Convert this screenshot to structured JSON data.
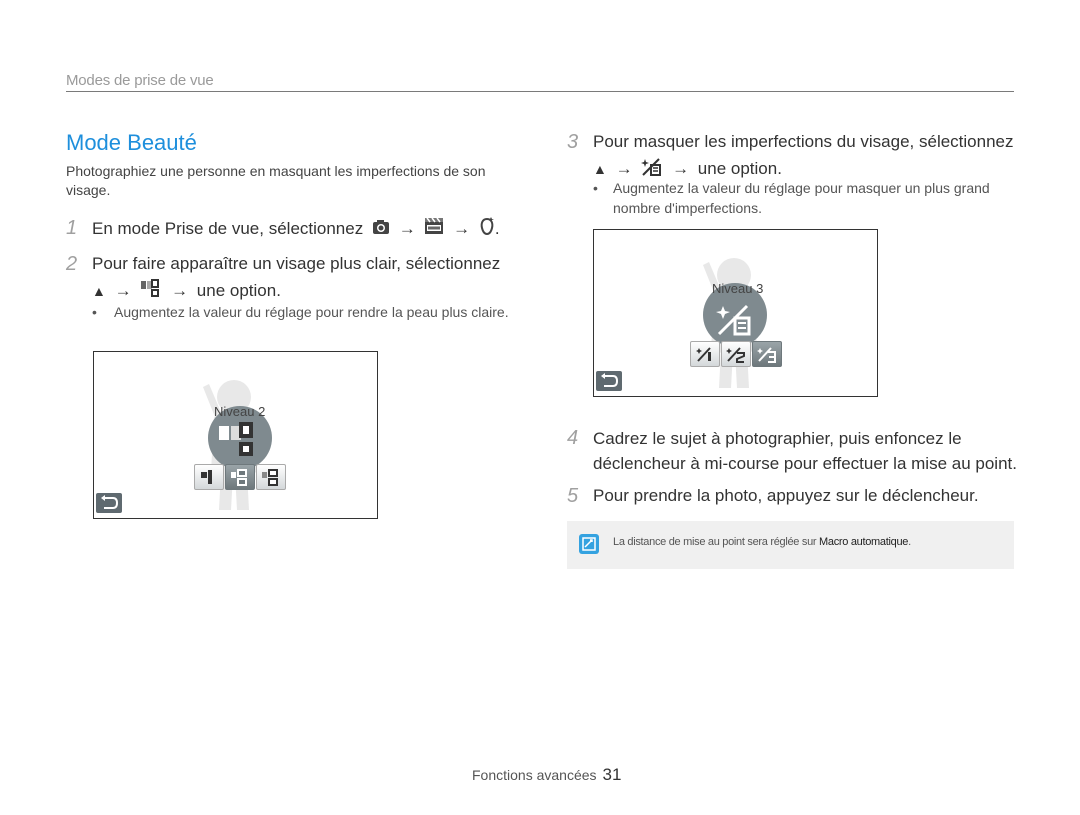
{
  "header": {
    "section": "Modes de prise de vue"
  },
  "title": "Mode Beauté",
  "intro": "Photographiez une personne en masquant les imperfections de son visage.",
  "steps": [
    {
      "num": "1",
      "text": "En mode Prise de vue, sélectionnez",
      "tail": "."
    },
    {
      "num": "2",
      "text": "Pour faire apparaître un visage plus clair, sélectionnez",
      "tail": "une option.",
      "bullet": "Augmentez la valeur du réglage pour rendre la peau plus claire."
    },
    {
      "num": "3",
      "text": "Pour masquer les imperfections du visage, sélectionnez",
      "tail": "une option.",
      "bullet": "Augmentez la valeur du réglage pour masquer un plus grand nombre d'imperfections."
    },
    {
      "num": "4",
      "text": "Cadrez le sujet à photographier, puis enfoncez le déclencheur à mi-course pour effectuer la mise au point."
    },
    {
      "num": "5",
      "text": "Pour prendre la photo, appuyez sur le déclencheur."
    }
  ],
  "screen1": {
    "level_label": "Niveau 2",
    "options": 3,
    "selected": 2
  },
  "screen2": {
    "level_label": "Niveau 3",
    "options": 3,
    "selected": 3
  },
  "note": {
    "text_before": "La distance de mise au point sera réglée sur",
    "highlight": "Macro automatique",
    "text_after": "."
  },
  "footer": {
    "label": "Fonctions avancées",
    "page": "31"
  },
  "icons": {
    "arrow": "→",
    "up": "▲"
  },
  "colors": {
    "title_blue": "#1e8fdc",
    "note_icon": "#34a2e0",
    "circle": "#7f8a8f"
  }
}
